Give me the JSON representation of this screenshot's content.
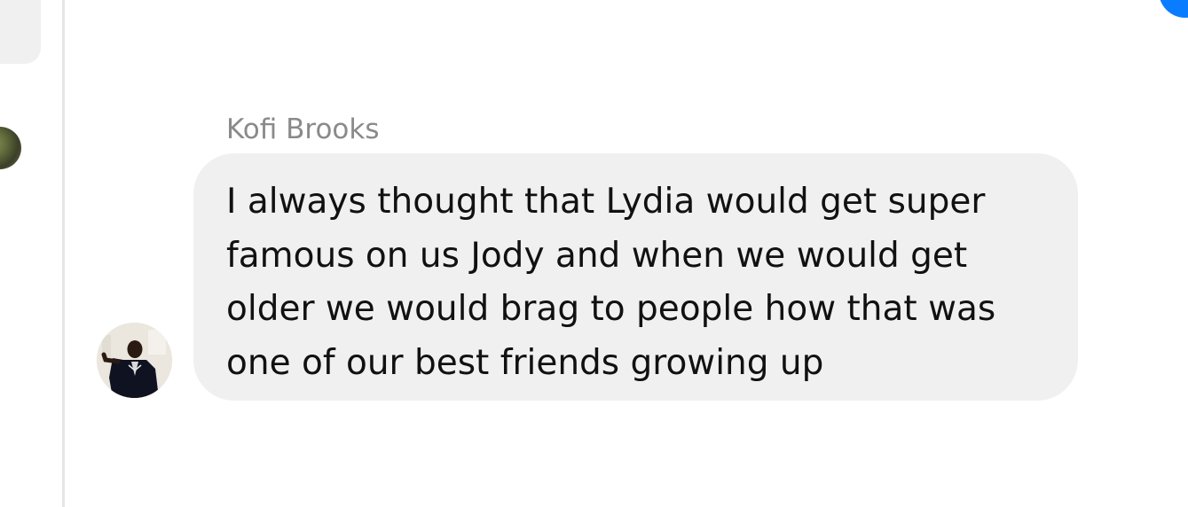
{
  "message": {
    "sender_name": "Kofi Brooks",
    "text": "I always thought that Lydia would get super\nfamous on us Jody and when we would get\nolder we would brag to people how that was\none of our best friends growing up"
  },
  "colors": {
    "bubble_background": "#f0f0f0",
    "sender_name": "#8a8a8a",
    "accent_blue": "#0a7cff",
    "divider": "#e6e6e6"
  },
  "icons": {
    "sender_avatar": "user-avatar",
    "left_avatar": "user-avatar"
  }
}
